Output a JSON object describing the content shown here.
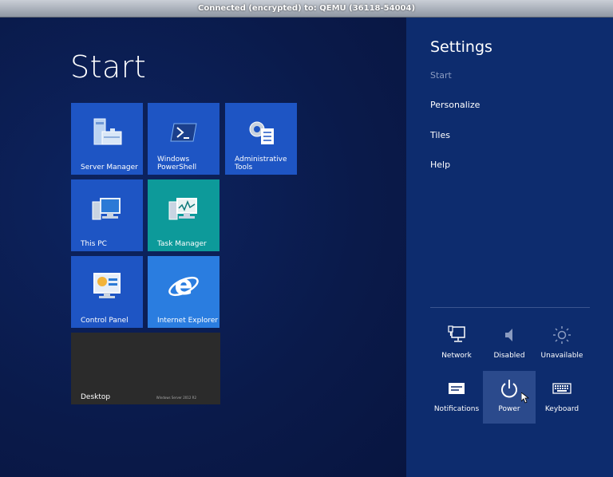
{
  "window": {
    "title": "Connected (encrypted) to: QEMU (36118-54004)"
  },
  "start": {
    "title": "Start",
    "tiles": [
      {
        "label": "Server Manager"
      },
      {
        "label": "Windows PowerShell"
      },
      {
        "label": "Administrative Tools"
      },
      {
        "label": "This PC"
      },
      {
        "label": "Task Manager"
      },
      {
        "label": "Control Panel"
      },
      {
        "label": "Internet Explorer"
      },
      {
        "label": "Desktop",
        "branding": "Windows Server 2012 R2"
      }
    ]
  },
  "settings": {
    "title": "Settings",
    "links": [
      "Start",
      "Personalize",
      "Tiles",
      "Help"
    ],
    "quick": [
      {
        "label": "Network",
        "icon": "network-icon"
      },
      {
        "label": "Disabled",
        "icon": "volume-icon"
      },
      {
        "label": "Unavailable",
        "icon": "brightness-icon"
      },
      {
        "label": "Notifications",
        "icon": "notifications-icon"
      },
      {
        "label": "Power",
        "icon": "power-icon"
      },
      {
        "label": "Keyboard",
        "icon": "keyboard-icon"
      }
    ]
  },
  "colors": {
    "accent": "#1e55c4",
    "charm_bg": "#0d2c6e",
    "start_bg": "#0a1a4a"
  }
}
